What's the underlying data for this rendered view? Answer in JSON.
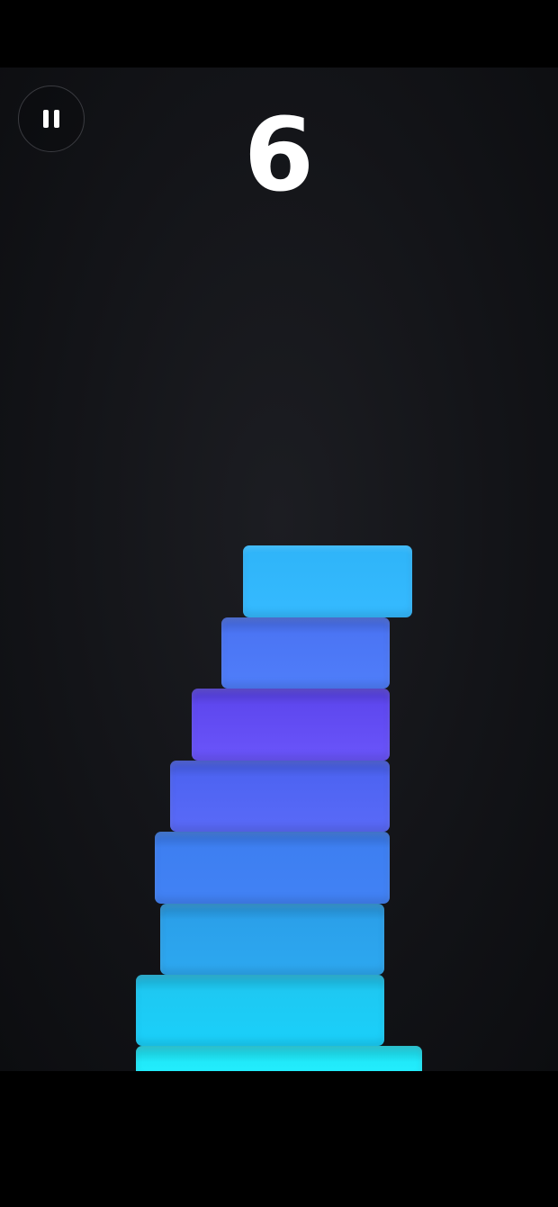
{
  "game": {
    "score": "6"
  },
  "controls": {
    "pause_icon": "pause-icon"
  },
  "tower": {
    "blocks": [
      {
        "color_top": "#1ee4f6",
        "color_bottom": "#24f0ff"
      },
      {
        "color_top": "#1fc6f0",
        "color_bottom": "#1ad0fa"
      },
      {
        "color_top": "#2a9ee8",
        "color_bottom": "#2da8f0"
      },
      {
        "color_top": "#3c7ef0",
        "color_bottom": "#4282f5"
      },
      {
        "color_top": "#4a62f0",
        "color_bottom": "#5a6af8"
      },
      {
        "color_top": "#5b44ec",
        "color_bottom": "#6a55fa"
      },
      {
        "color_top": "#4a72f2",
        "color_bottom": "#4f7efa"
      },
      {
        "color_top": "#2fb4f8",
        "color_bottom": "#35baff"
      }
    ]
  }
}
